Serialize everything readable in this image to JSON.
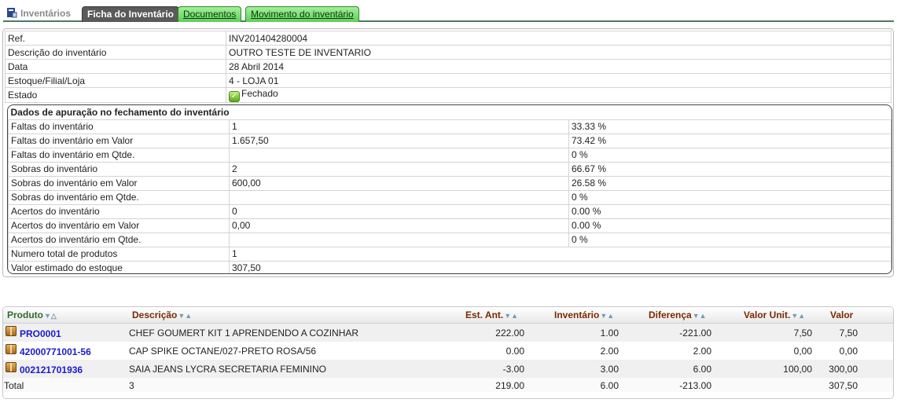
{
  "tabs": {
    "home": "Inventários",
    "ficha": "Ficha do Inventário",
    "documentos": "Documentos",
    "movimento": "Movimento do inventário"
  },
  "details": [
    {
      "label": "Ref.",
      "value": "INV201404280004"
    },
    {
      "label": "Descrição do inventário",
      "value": "OUTRO TESTE DE INVENTARIO"
    },
    {
      "label": "Data",
      "value": "28 Abril 2014"
    },
    {
      "label": "Estoque/Filial/Loja",
      "value": "4 - LOJA 01"
    },
    {
      "label": "Estado",
      "value": "Fechado"
    }
  ],
  "summary": {
    "heading": "Dados de apuração no fechamento do inventário",
    "rows": [
      {
        "label": "Faltas do inventário",
        "value": "1",
        "pct": "33.33 %"
      },
      {
        "label": "Faltas do inventário em Valor",
        "value": "1.657,50",
        "pct": "73.42 %"
      },
      {
        "label": "Faltas do inventário em Qtde.",
        "value": "",
        "pct": "0 %"
      },
      {
        "label": "Sobras do inventário",
        "value": "2",
        "pct": "66.67 %"
      },
      {
        "label": "Sobras do inventário em Valor",
        "value": "600,00",
        "pct": "26.58 %"
      },
      {
        "label": "Sobras do inventário em Qtde.",
        "value": "",
        "pct": "0 %"
      },
      {
        "label": "Acertos do inventário",
        "value": "0",
        "pct": "0.00 %"
      },
      {
        "label": "Acertos do inventário em Valor",
        "value": "0,00",
        "pct": "0.00 %"
      },
      {
        "label": "Acertos do inventário em Qtde.",
        "value": "",
        "pct": "0 %"
      },
      {
        "label": "Numero total de produtos",
        "value": "1",
        "pct": null
      },
      {
        "label": "Valor estimado do estoque",
        "value": "307,50",
        "pct": null
      }
    ]
  },
  "products": {
    "columns": {
      "produto": "Produto",
      "descricao": "Descrição",
      "est_ant": "Est. Ant.",
      "inventario": "Inventário",
      "diferenca": "Diferença",
      "valor_unit": "Valor Unit.",
      "valor": "Valor"
    },
    "rows": [
      {
        "code": "PRO0001",
        "desc": "CHEF GOUMERT KIT 1 APRENDENDO A COZINHAR",
        "est_ant": "222.00",
        "inventario": "1.00",
        "diferenca": "-221.00",
        "valor_unit": "7,50",
        "valor": "7,50"
      },
      {
        "code": "42000771001-56",
        "desc": "CAP SPIKE OCTANE/027-PRETO ROSA/56",
        "est_ant": "0.00",
        "inventario": "2.00",
        "diferenca": "2.00",
        "valor_unit": "0,00",
        "valor": "0,00"
      },
      {
        "code": "002121701936",
        "desc": "SAIA JEANS LYCRA SECRETARIA FEMININO",
        "est_ant": "-3.00",
        "inventario": "3.00",
        "diferenca": "6.00",
        "valor_unit": "100,00",
        "valor": "300,00"
      }
    ],
    "total": {
      "label": "Total",
      "count": "3",
      "est_ant": "219.00",
      "inventario": "6.00",
      "diferenca": "-213.00",
      "valor": "307,50"
    }
  }
}
